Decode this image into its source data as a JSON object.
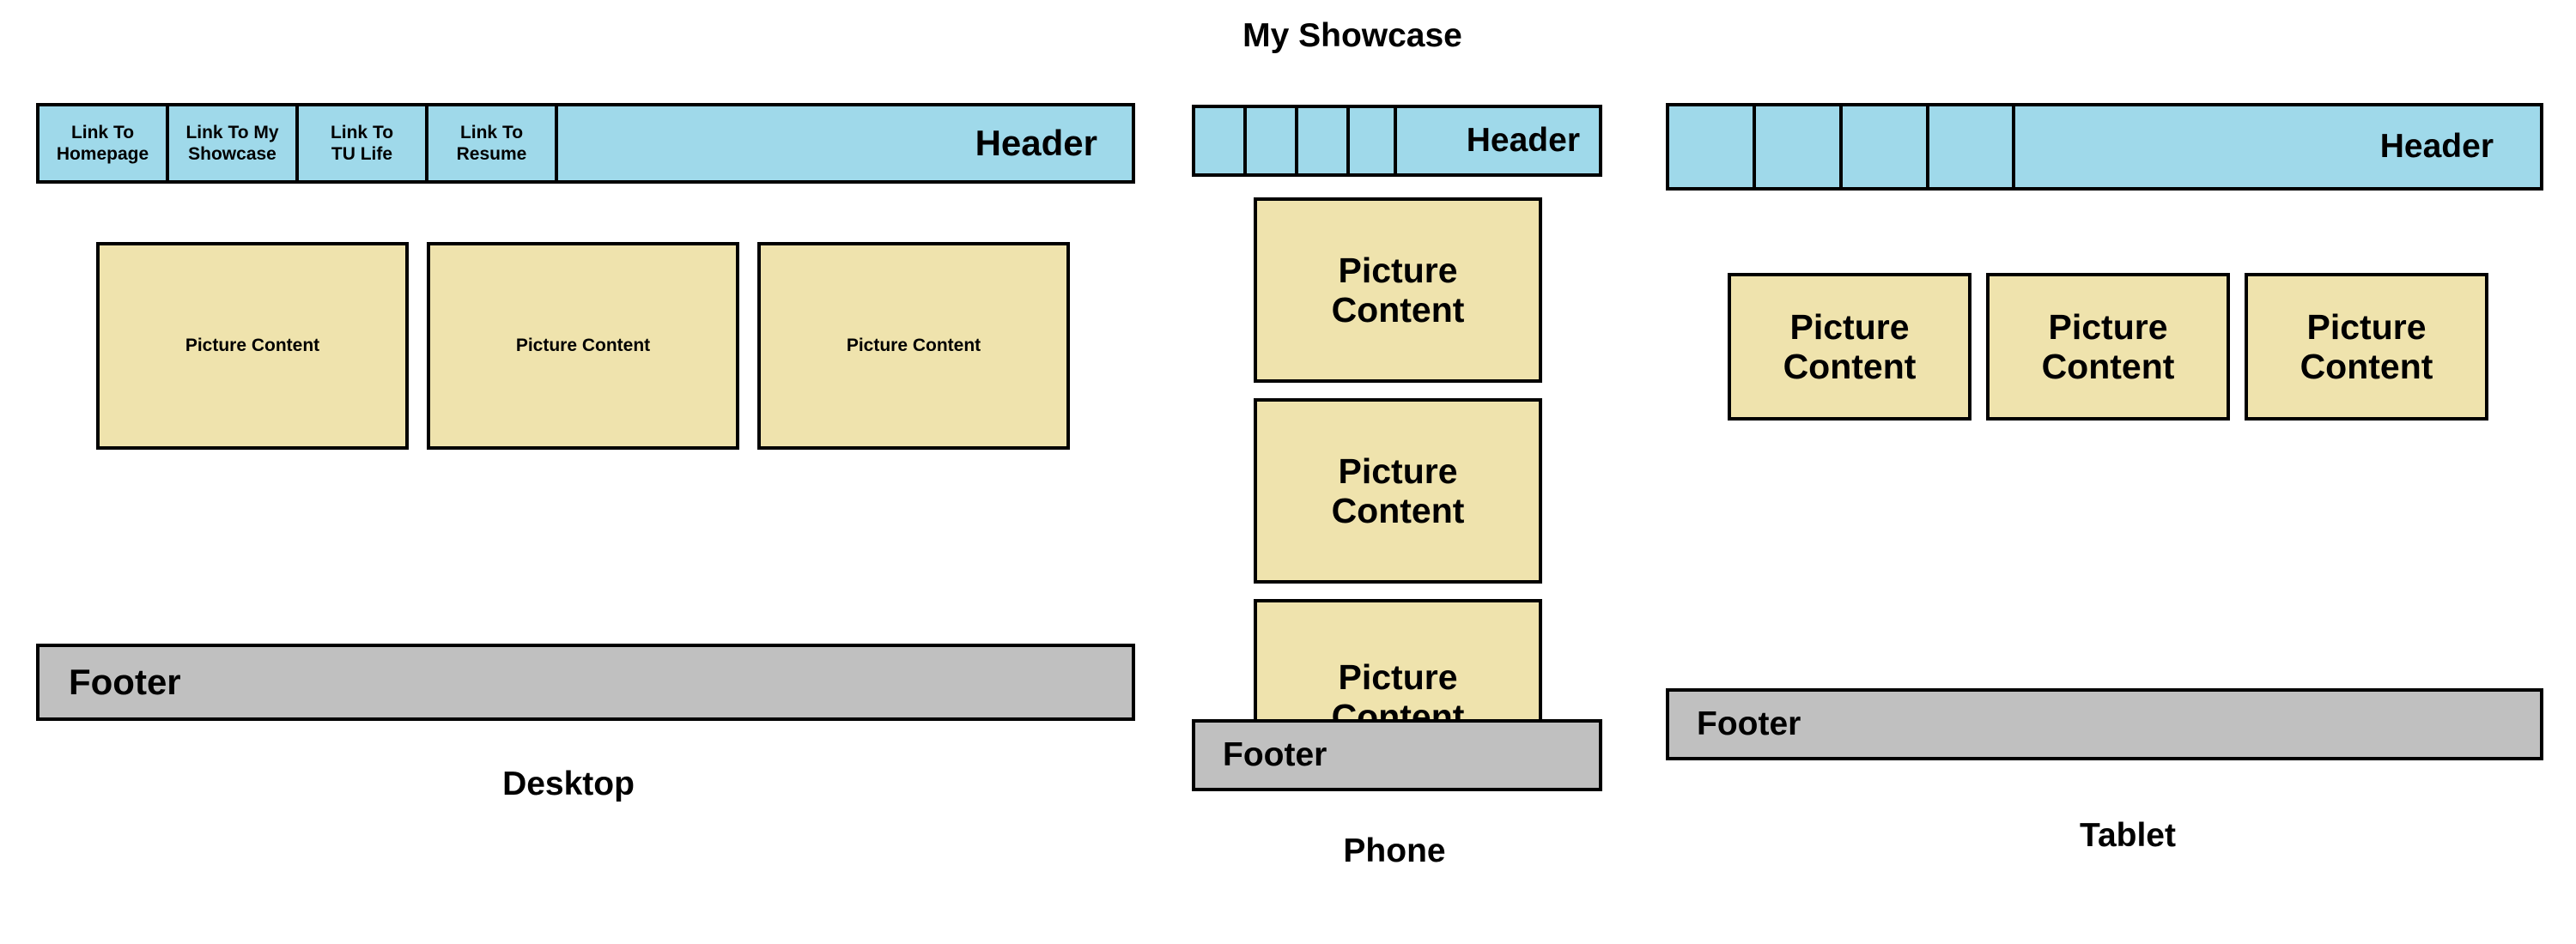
{
  "title": "My Showcase",
  "desktop": {
    "caption": "Desktop",
    "nav_links": [
      "Link To Homepage",
      "Link To My Showcase",
      "Link To TU Life",
      "Link To Resume"
    ],
    "header_label": "Header",
    "pictures": [
      "Picture Content",
      "Picture Content",
      "Picture Content"
    ],
    "footer_label": "Footer"
  },
  "phone": {
    "caption": "Phone",
    "header_label": "Header",
    "pictures": [
      "Picture Content",
      "Picture Content",
      "Picture Content"
    ],
    "footer_label": "Footer"
  },
  "tablet": {
    "caption": "Tablet",
    "header_label": "Header",
    "pictures": [
      "Picture Content",
      "Picture Content",
      "Picture Content"
    ],
    "footer_label": "Footer"
  },
  "colors": {
    "header": "#9fd9ea",
    "picture": "#efe3ad",
    "footer": "#c0c0c0",
    "border": "#000000"
  }
}
